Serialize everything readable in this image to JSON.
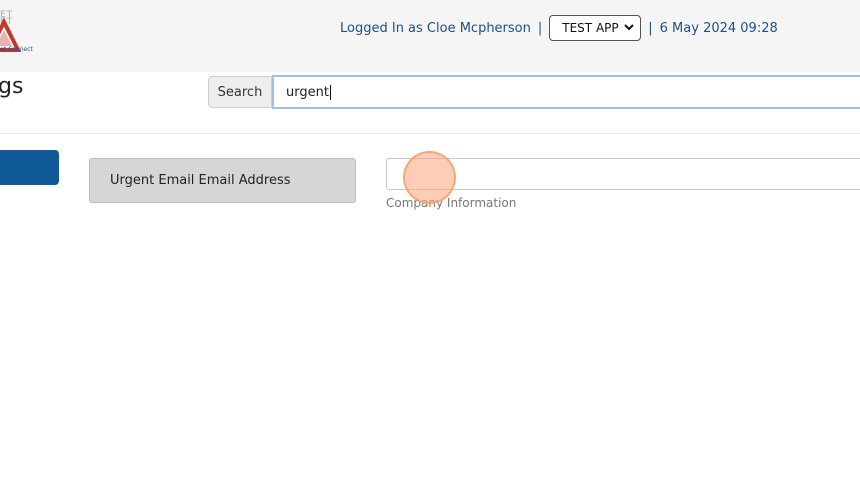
{
  "header": {
    "logo_text_top": "ET\nET",
    "logo_text_bottom": "et Connect",
    "logged_in_text": "Logged In as Cloe Mcpherson",
    "separator": "|",
    "app_select_value": "TEST APP",
    "datetime": "6 May 2024 09:28"
  },
  "page": {
    "title": "gs"
  },
  "search": {
    "button_label": "Search",
    "value": "urgent"
  },
  "setting": {
    "label": "Urgent Email Email Address",
    "input_value": "",
    "help_text": "Company Information"
  },
  "colors": {
    "header_text": "#1f4f8a",
    "primary_button": "#0f5a96",
    "click_indicator": "#fca578"
  },
  "icons": {
    "logo": "warning-triangle-logo",
    "select_chevron": "chevron-down-icon"
  }
}
